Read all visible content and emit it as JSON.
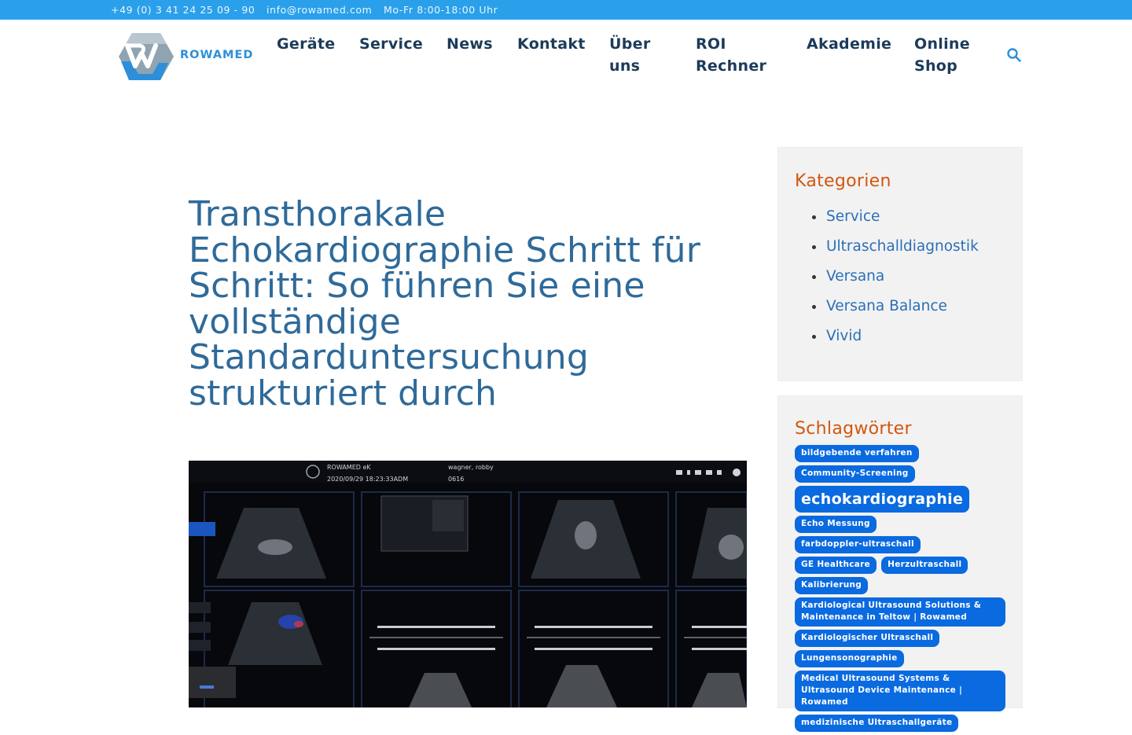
{
  "topbar": {
    "phone": "+49 (0) 3 41 24 25 09 - 90",
    "email": "info@rowamed.com",
    "hours": "Mo-Fr 8:00-18:00 Uhr"
  },
  "logo": {
    "text": "ROWAMED",
    "brand_color": "#2d8fd9"
  },
  "nav": {
    "items": [
      {
        "label": "Geräte"
      },
      {
        "label": "Service"
      },
      {
        "label": "News"
      },
      {
        "label": "Kontakt"
      },
      {
        "line1": "Über",
        "line2": "uns"
      },
      {
        "line1": "ROI",
        "line2": "Rechner"
      },
      {
        "label": "Akademie"
      },
      {
        "line1": "Online",
        "line2": "Shop"
      }
    ],
    "search_icon": "search-icon"
  },
  "article": {
    "title": "Transthorakale Echokardiographie Schritt für Schritt: So führen Sie eine vollständige Standarduntersuchung strukturiert durch",
    "image_overlay": {
      "header1": "ROWAMED eK",
      "header2": "2020/09/29 18:23:33ADM",
      "header3": "wagner, robby",
      "header4": "0616"
    }
  },
  "sidebar": {
    "categories_title": "Kategorien",
    "categories": [
      "Service",
      "Ultraschalldiagnostik",
      "Versana",
      "Versana Balance",
      "Vivid"
    ],
    "tags_title": "Schlagwörter",
    "tags": [
      "bildgebende verfahren",
      "Community-Screening",
      "echokardiographie",
      "Echo Messung",
      "farbdoppler-ultraschall",
      "GE Healthcare",
      "Herzultraschall",
      "Kalibrierung",
      "Kardiological Ultrasound Solutions & Maintenance in Teltow | Rowamed",
      "Kardiologischer Ultraschall",
      "Lungensonographie",
      "Medical Ultrasound Systems & Ultrasound Device Maintenance | Rowamed",
      "medizinische Ultraschallgeräte"
    ]
  },
  "colors": {
    "topbar": "#2aa0ea",
    "title": "#2f6a99",
    "widget_heading": "#d2560f",
    "link": "#2a6fb8",
    "tag_bg": "#0a6ae0"
  }
}
